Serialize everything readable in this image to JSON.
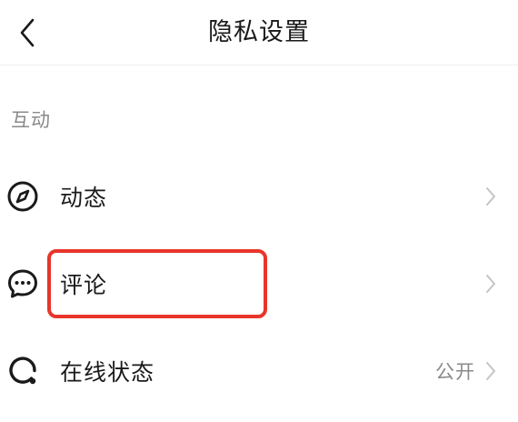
{
  "header": {
    "title": "隐私设置",
    "back_icon": "chevron-left-icon"
  },
  "section": {
    "label": "互动"
  },
  "items": [
    {
      "label": "动态",
      "icon": "compass-icon",
      "value": ""
    },
    {
      "label": "评论",
      "icon": "comment-bubble-icon",
      "value": ""
    },
    {
      "label": "在线状态",
      "icon": "online-status-icon",
      "value": "公开"
    }
  ],
  "colors": {
    "text": "#1a1a1a",
    "secondary_text": "#8a8a8a",
    "chevron": "#c4c4c4",
    "highlight": "#e8352b",
    "divider": "#eeeeee"
  }
}
